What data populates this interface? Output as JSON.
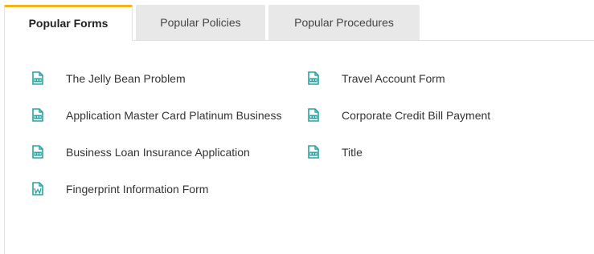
{
  "tabs": [
    {
      "label": "Popular Forms",
      "active": true
    },
    {
      "label": "Popular Policies",
      "active": false
    },
    {
      "label": "Popular Procedures",
      "active": false
    }
  ],
  "colors": {
    "accent": "#f2b416",
    "icon": "#2aa3a0",
    "tab_inactive_bg": "#e8e8e8"
  },
  "forms_left": [
    {
      "label": "The Jelly Bean Problem",
      "icon": "pdf-document-icon"
    },
    {
      "label": "Application Master Card Platinum Business",
      "icon": "pdf-document-icon"
    },
    {
      "label": "Business Loan Insurance Application",
      "icon": "pdf-document-icon"
    },
    {
      "label": "Fingerprint Information Form",
      "icon": "word-document-icon"
    }
  ],
  "forms_right": [
    {
      "label": "Travel Account Form",
      "icon": "pdf-document-icon"
    },
    {
      "label": "Corporate Credit Bill Payment",
      "icon": "pdf-document-icon"
    },
    {
      "label": "Title",
      "icon": "pdf-document-icon"
    }
  ]
}
